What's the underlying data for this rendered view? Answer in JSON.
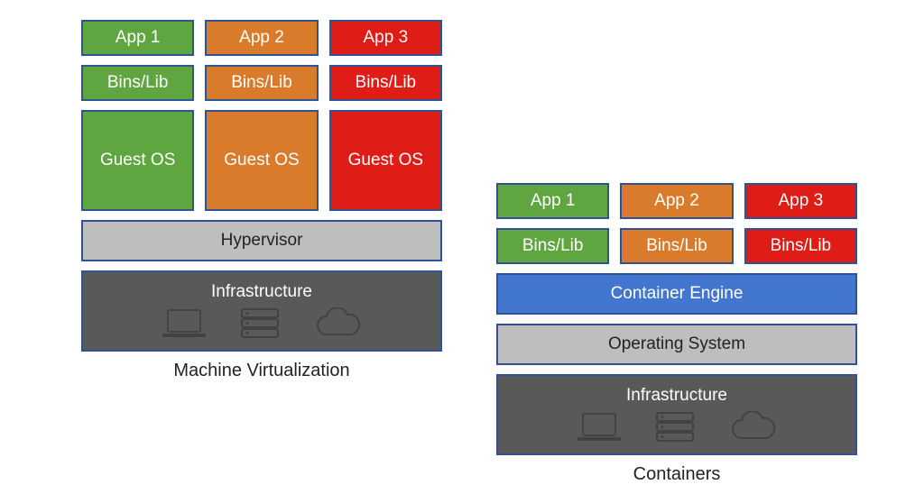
{
  "left": {
    "caption": "Machine Virtualization",
    "cols": [
      {
        "app": "App 1",
        "bins": "Bins/Lib",
        "os": "Guest OS",
        "color": "green"
      },
      {
        "app": "App 2",
        "bins": "Bins/Lib",
        "os": "Guest OS",
        "color": "orange"
      },
      {
        "app": "App 3",
        "bins": "Bins/Lib",
        "os": "Guest OS",
        "color": "red"
      }
    ],
    "layers": {
      "hypervisor": "Hypervisor",
      "infrastructure": "Infrastructure"
    }
  },
  "right": {
    "caption": "Containers",
    "cols": [
      {
        "app": "App 1",
        "bins": "Bins/Lib",
        "color": "green"
      },
      {
        "app": "App 2",
        "bins": "Bins/Lib",
        "color": "orange"
      },
      {
        "app": "App 3",
        "bins": "Bins/Lib",
        "color": "red"
      }
    ],
    "layers": {
      "engine": "Container Engine",
      "os": "Operating System",
      "infrastructure": "Infrastructure"
    }
  },
  "colors": {
    "green": "#5fa641",
    "orange": "#d97b2b",
    "red": "#e01c17",
    "blue": "#4377cf",
    "border": "#2f5396",
    "lightgray": "#bebebe",
    "darkgray": "#595959"
  }
}
